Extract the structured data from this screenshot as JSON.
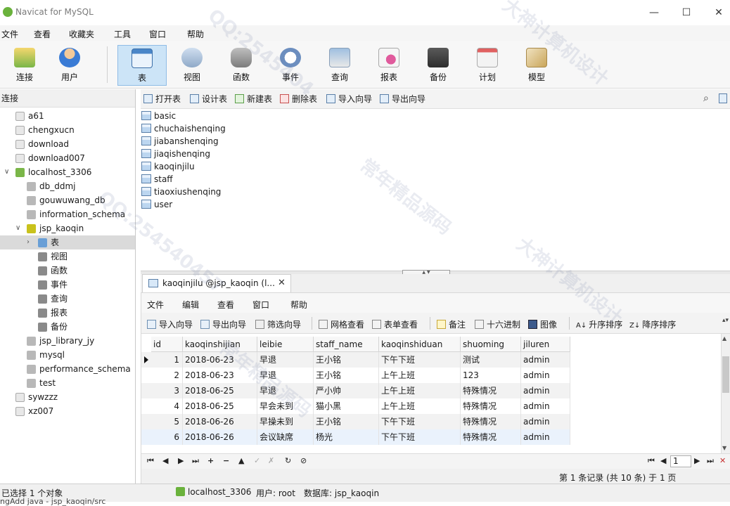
{
  "window": {
    "title": "Navicat for MySQL",
    "controls": [
      "—",
      "☐",
      "✕"
    ]
  },
  "menu": [
    "文件",
    "查看",
    "收藏夹",
    "工具",
    "窗口",
    "帮助"
  ],
  "toolbar": {
    "buttons": [
      {
        "label": "连接",
        "icon": "connection-icon"
      },
      {
        "label": "用户",
        "icon": "user-icon"
      },
      {
        "label": "表",
        "icon": "table-icon",
        "active": true
      },
      {
        "label": "视图",
        "icon": "view-icon"
      },
      {
        "label": "函数",
        "icon": "function-icon"
      },
      {
        "label": "事件",
        "icon": "event-icon"
      },
      {
        "label": "查询",
        "icon": "query-icon"
      },
      {
        "label": "报表",
        "icon": "report-icon"
      },
      {
        "label": "备份",
        "icon": "backup-icon"
      },
      {
        "label": "计划",
        "icon": "schedule-icon"
      },
      {
        "label": "模型",
        "icon": "model-icon"
      }
    ]
  },
  "left_panel": {
    "header": "连接",
    "tree": [
      {
        "label": "a61",
        "level": 1,
        "kind": "connection"
      },
      {
        "label": "chengxucn",
        "level": 1,
        "kind": "connection"
      },
      {
        "label": "download",
        "level": 1,
        "kind": "connection"
      },
      {
        "label": "download007",
        "level": 1,
        "kind": "connection"
      },
      {
        "label": "localhost_3306",
        "level": 1,
        "kind": "connection-open",
        "toggle": "∨"
      },
      {
        "label": "db_ddmj",
        "level": 2,
        "kind": "database"
      },
      {
        "label": "gouwuwang_db",
        "level": 2,
        "kind": "database"
      },
      {
        "label": "information_schema",
        "level": 2,
        "kind": "database"
      },
      {
        "label": "jsp_kaoqin",
        "level": 2,
        "kind": "database-open",
        "toggle": "∨"
      },
      {
        "label": "表",
        "level": 3,
        "kind": "tables",
        "toggle": "›",
        "selected": true
      },
      {
        "label": "视图",
        "level": 3,
        "kind": "views"
      },
      {
        "label": "函数",
        "level": 3,
        "kind": "functions"
      },
      {
        "label": "事件",
        "level": 3,
        "kind": "events"
      },
      {
        "label": "查询",
        "level": 3,
        "kind": "queries"
      },
      {
        "label": "报表",
        "level": 3,
        "kind": "reports"
      },
      {
        "label": "备份",
        "level": 3,
        "kind": "backups"
      },
      {
        "label": "jsp_library_jy",
        "level": 2,
        "kind": "database"
      },
      {
        "label": "mysql",
        "level": 2,
        "kind": "database"
      },
      {
        "label": "performance_schema",
        "level": 2,
        "kind": "database"
      },
      {
        "label": "test",
        "level": 2,
        "kind": "database"
      },
      {
        "label": "sywzzz",
        "level": 1,
        "kind": "connection"
      },
      {
        "label": "xz007",
        "level": 1,
        "kind": "connection"
      }
    ]
  },
  "object_toolbar": [
    "打开表",
    "设计表",
    "新建表",
    "删除表",
    "导入向导",
    "导出向导"
  ],
  "object_list": [
    "basic",
    "chuchaishenqing",
    "jiabanshenqing",
    "jiaqishenqing",
    "kaoqinjilu",
    "staff",
    "tiaoxiushenqing",
    "user"
  ],
  "tab": {
    "label": "kaoqinjilu @jsp_kaoqin (l...",
    "close": "✕"
  },
  "sub_menu": [
    "文件",
    "编辑",
    "查看",
    "窗口",
    "帮助"
  ],
  "sub_toolbar": [
    "导入向导",
    "导出向导",
    "筛选向导",
    "网格查看",
    "表单查看",
    "备注",
    "十六进制",
    "图像",
    "升序排序",
    "降序排序"
  ],
  "grid": {
    "columns": [
      "id",
      "kaoqinshijian",
      "leibie",
      "staff_name",
      "kaoqinshiduan",
      "shuoming",
      "jiluren"
    ],
    "rows": [
      [
        "1",
        "2018-06-23",
        "早退",
        "王小铭",
        "下午下班",
        "测试",
        "admin"
      ],
      [
        "2",
        "2018-06-23",
        "早退",
        "王小铭",
        "上午上班",
        "123",
        "admin"
      ],
      [
        "3",
        "2018-06-25",
        "早退",
        "严小帅",
        "上午上班",
        "特殊情况",
        "admin"
      ],
      [
        "4",
        "2018-06-25",
        "早会未到",
        "猫小黑",
        "上午上班",
        "特殊情况",
        "admin"
      ],
      [
        "5",
        "2018-06-26",
        "早操未到",
        "王小铭",
        "下午下班",
        "特殊情况",
        "admin"
      ],
      [
        "6",
        "2018-06-26",
        "会议缺席",
        "杨光",
        "下午下班",
        "特殊情况",
        "admin"
      ]
    ]
  },
  "nav": {
    "buttons": [
      "⏮",
      "◀",
      "▶",
      "⏭",
      "+",
      "−",
      "▲",
      "✓",
      "✗",
      "↻",
      "⊘"
    ],
    "page": "1",
    "record_info": "第 1 条记录 (共 10 条) 于 1 页"
  },
  "status": {
    "selection": "已选择 1 个对象",
    "connection": "localhost_3306",
    "user": "用户: root",
    "database": "数据库: jsp_kaoqin",
    "bottom_path": "ngAdd java - jsp_kaoqin/src"
  },
  "watermarks": [
    "QQ:2545404",
    "大神计算机设计",
    "常年精品源码",
    "QQ:254540457",
    "大神计算机设计",
    "常年精品源码"
  ],
  "colors": {
    "accent": "#cce4f7",
    "selection": "#dadada",
    "row_alt": "#f2f2f2"
  }
}
